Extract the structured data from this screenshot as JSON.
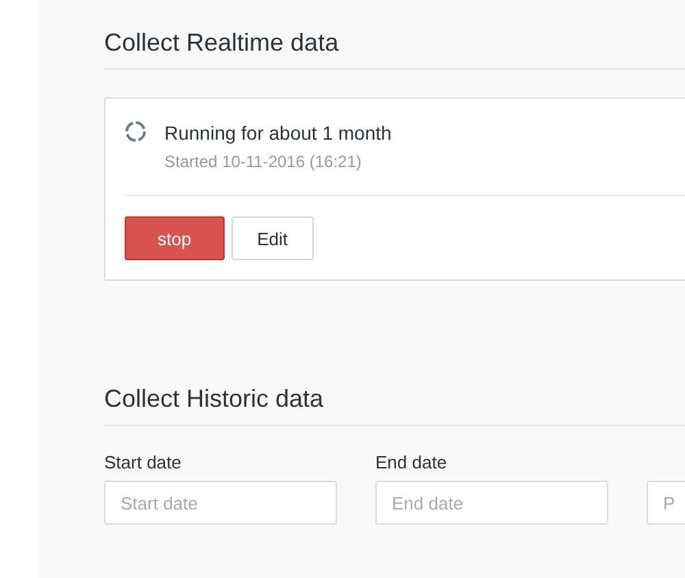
{
  "realtime": {
    "title": "Collect Realtime data",
    "status": {
      "running": true,
      "headline": "Running for about 1 month",
      "started": "Started 10-11-2016 (16:21)"
    },
    "buttons": [
      {
        "label": "stop",
        "kind": "danger"
      },
      {
        "label": "Edit",
        "kind": "default"
      }
    ]
  },
  "historic": {
    "title": "Collect Historic data",
    "fields": [
      {
        "label": "Start date",
        "placeholder": "Start date"
      },
      {
        "label": "End date",
        "placeholder": "End date"
      },
      {
        "placeholder": "P"
      }
    ]
  }
}
